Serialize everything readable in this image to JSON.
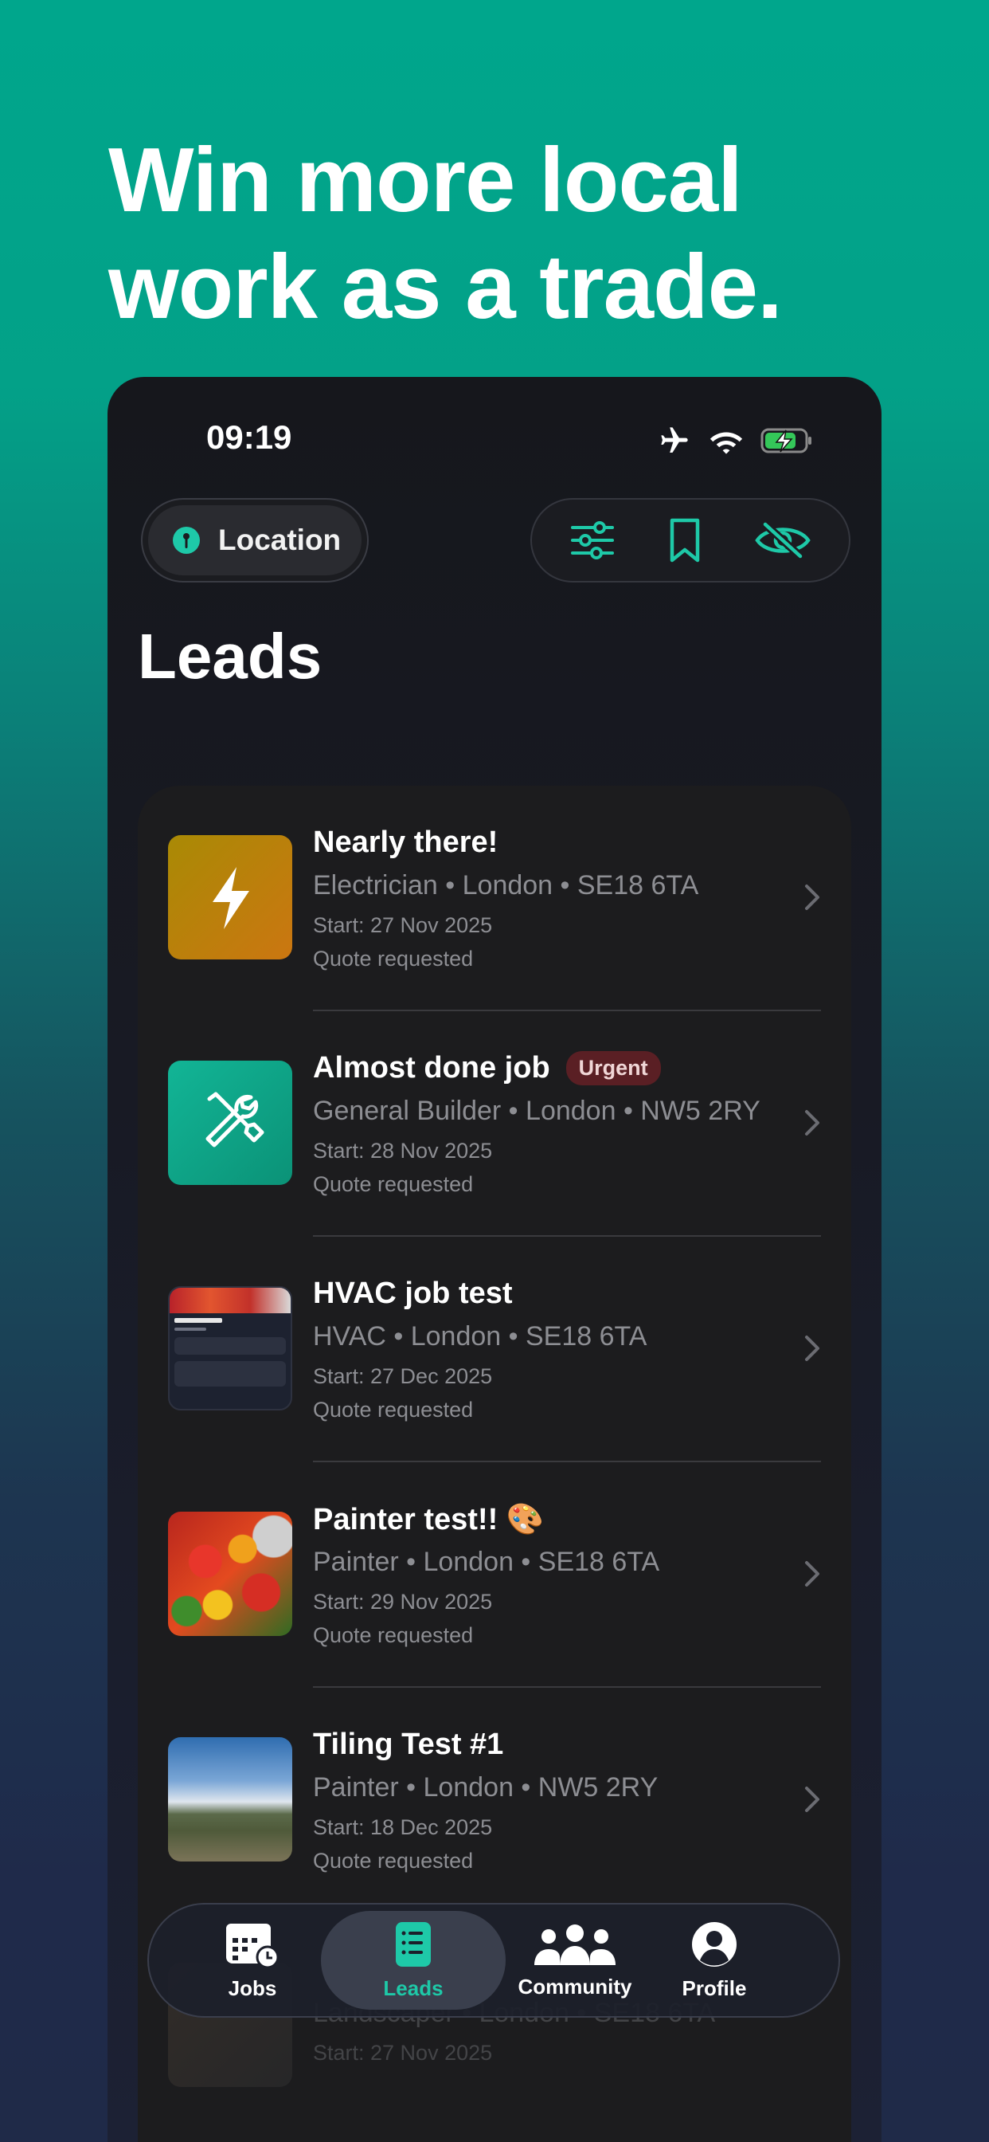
{
  "headline": {
    "line1": "Win more local",
    "line2": "work as a trade."
  },
  "status_bar": {
    "time": "09:19",
    "icons": [
      "airplane-icon",
      "wifi-icon",
      "battery-charging-icon"
    ]
  },
  "toolbar": {
    "location_label": "Location",
    "actions": [
      "filter-icon",
      "bookmark-icon",
      "hidden-eye-icon"
    ]
  },
  "page": {
    "title": "Leads"
  },
  "leads": [
    {
      "title": "Nearly there!",
      "badge": "",
      "subtitle": "Electrician • London • SE18 6TA",
      "start": "Start: 27 Nov 2025",
      "status": "Quote requested",
      "thumb": "lightning-icon"
    },
    {
      "title": "Almost done job",
      "badge": "Urgent",
      "subtitle": "General Builder • London • NW5 2RY",
      "start": "Start: 28 Nov 2025",
      "status": "Quote requested",
      "thumb": "tools-icon"
    },
    {
      "title": "HVAC job test",
      "badge": "",
      "subtitle": "HVAC • London • SE18 6TA",
      "start": "Start: 27 Dec 2025",
      "status": "Quote requested",
      "thumb": "screenshot-thumbnail"
    },
    {
      "title": "Painter test!! 🎨",
      "badge": "",
      "subtitle": "Painter • London • SE18 6TA",
      "start": "Start: 29 Nov 2025",
      "status": "Quote requested",
      "thumb": "peppers-photo"
    },
    {
      "title": "Tiling Test #1",
      "badge": "",
      "subtitle": "Painter • London • NW5 2RY",
      "start": "Start: 18 Dec 2025",
      "status": "Quote requested",
      "thumb": "landscape-photo"
    }
  ],
  "partial_row": {
    "subtitle": "Landscaper • London • SE18 6TA",
    "start": "Start: 27 Nov 2025"
  },
  "tabbar": {
    "tabs": [
      {
        "label": "Jobs",
        "icon": "calendar-clock-icon"
      },
      {
        "label": "Leads",
        "icon": "document-list-icon",
        "active": true
      },
      {
        "label": "Community",
        "icon": "people-icon"
      },
      {
        "label": "Profile",
        "icon": "person-circle-icon"
      }
    ]
  },
  "colors": {
    "accent": "#1ec9a8",
    "background_top": "#00a68c",
    "urgent": "#5a1f24"
  }
}
